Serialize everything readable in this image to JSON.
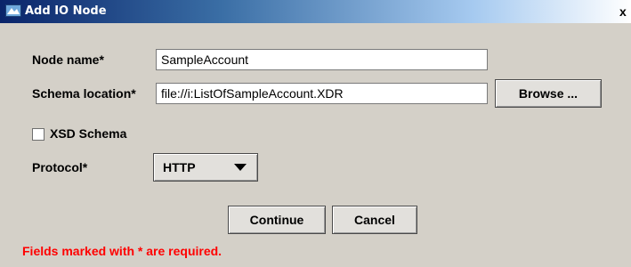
{
  "window": {
    "title": "Add IO Node",
    "close_glyph": "x"
  },
  "form": {
    "node_name_label": "Node name*",
    "node_name_value": "SampleAccount",
    "schema_location_label": "Schema location*",
    "schema_location_value": "file://i:ListOfSampleAccount.XDR",
    "browse_label": "Browse ...",
    "xsd_schema_label": "XSD Schema",
    "xsd_schema_checked": false,
    "protocol_label": "Protocol*",
    "protocol_selected": "HTTP"
  },
  "actions": {
    "continue_label": "Continue",
    "cancel_label": "Cancel"
  },
  "footer": {
    "required_note": "Fields marked with * are required."
  },
  "colors": {
    "dialog_background": "#d4d0c8",
    "titlebar_start": "#0a246a",
    "required_note": "#ff0000"
  },
  "icons": {
    "window": "app-window-icon",
    "dropdown": "triangle-down-icon"
  }
}
